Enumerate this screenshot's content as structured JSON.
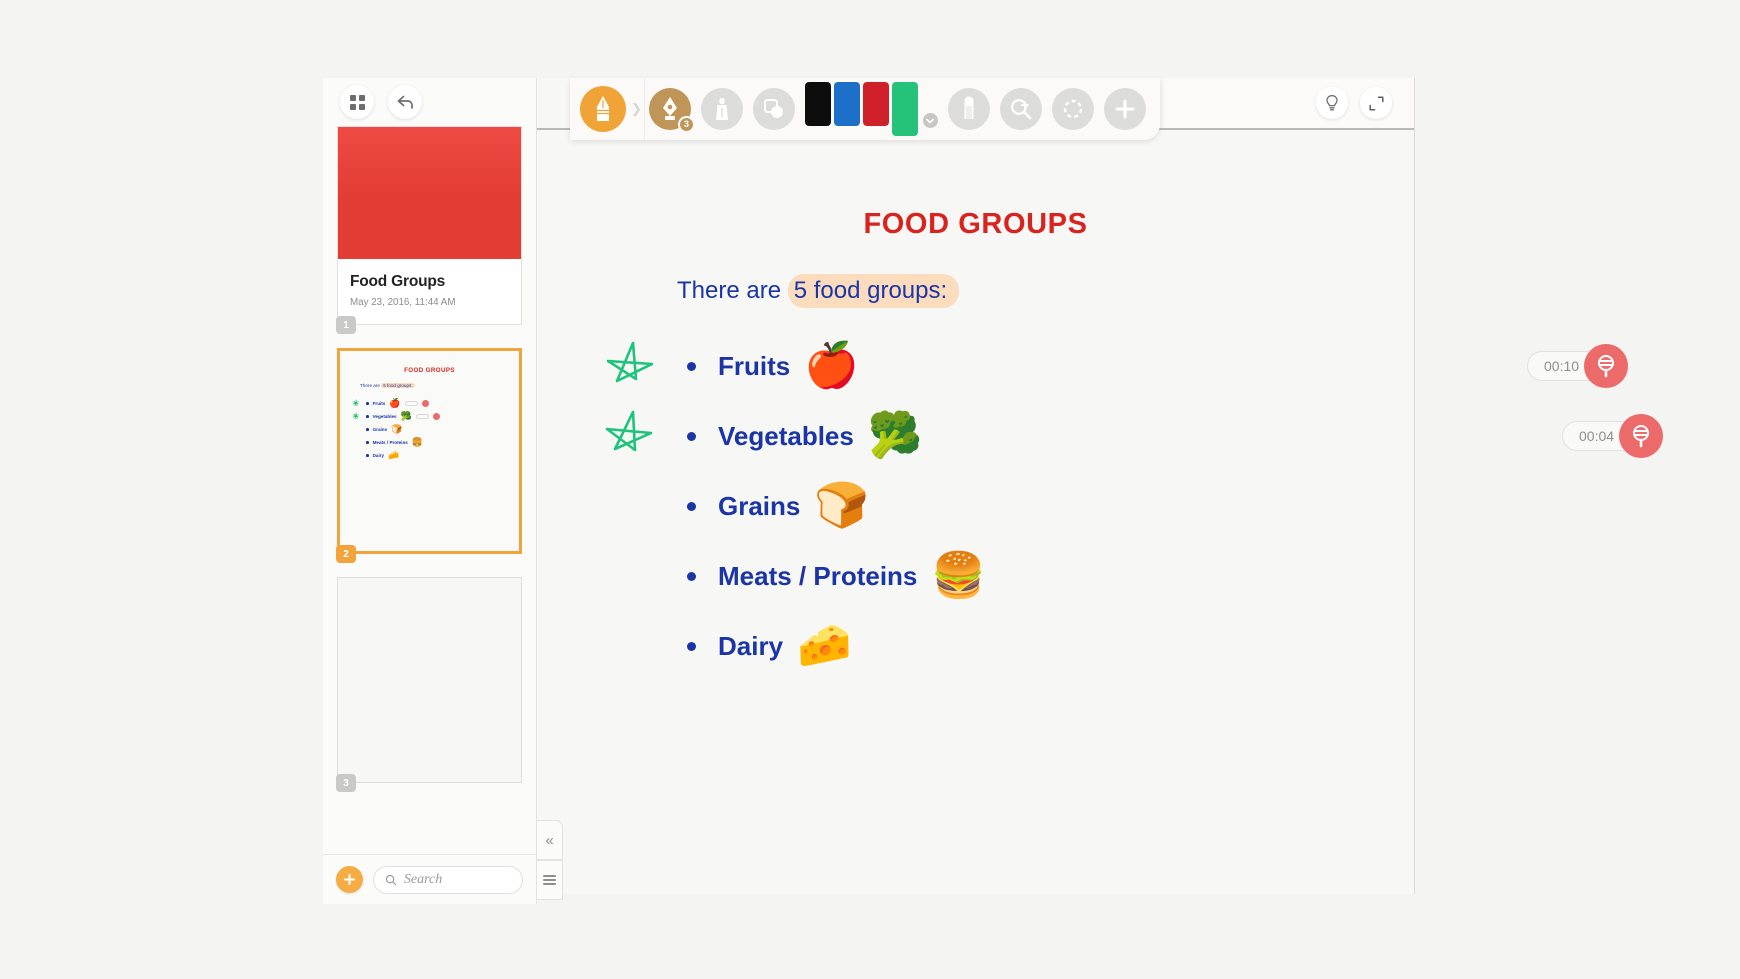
{
  "app": {
    "name": "notebook-presentation-editor"
  },
  "sidebar": {
    "top_buttons": [
      {
        "name": "grid-view-button",
        "icon": "grid-icon"
      },
      {
        "name": "back-button",
        "icon": "back-arrow-icon"
      }
    ],
    "slides": [
      {
        "number": "1",
        "type": "cover",
        "title": "Food Groups",
        "date": "May 23, 2016, 11:44 AM",
        "selected": false,
        "cover_color": "#e23c34"
      },
      {
        "number": "2",
        "type": "content",
        "selected": true,
        "thumb_title": "FOOD GROUPS",
        "thumb_sub_prefix": "There are ",
        "thumb_sub_hl": "5 food groups:",
        "thumb_items": [
          {
            "label": "Fruits",
            "food": "🍎",
            "star": true,
            "rec": true
          },
          {
            "label": "Vegetables",
            "food": "🥦",
            "star": true,
            "rec": true
          },
          {
            "label": "Grains",
            "food": "🍞",
            "star": false,
            "rec": false
          },
          {
            "label": "Meats / Proteins",
            "food": "🍔",
            "star": false,
            "rec": false
          },
          {
            "label": "Dairy",
            "food": "🧀",
            "star": false,
            "rec": false
          }
        ]
      },
      {
        "number": "3",
        "type": "empty",
        "selected": false
      }
    ],
    "add_button_label": "+",
    "search": {
      "placeholder": "Search",
      "value": ""
    }
  },
  "panel_controls": [
    {
      "name": "collapse-panel-button",
      "glyph": "«"
    },
    {
      "name": "panel-menu-button",
      "glyph": "menu"
    }
  ],
  "toolbar": {
    "active_tool": {
      "name": "pencil-tool",
      "color": "#f0a437"
    },
    "tools": [
      {
        "name": "pen-tool",
        "icon": "fountain-pen-icon",
        "color": "#bf9657",
        "badge": "3",
        "active": true
      },
      {
        "name": "highlighter-tool",
        "icon": "highlighter-icon",
        "color": "#dcdcda",
        "badge": "",
        "active": false
      },
      {
        "name": "shape-tool",
        "icon": "shapes-icon",
        "color": "#dcdcda",
        "badge": "",
        "active": false
      }
    ],
    "colors": [
      {
        "name": "swatch-black",
        "hex": "#0d0d0d",
        "selected": false
      },
      {
        "name": "swatch-blue",
        "hex": "#1c70c8",
        "selected": false
      },
      {
        "name": "swatch-red",
        "hex": "#cf2029",
        "selected": false
      },
      {
        "name": "swatch-green",
        "hex": "#25c279",
        "selected": true
      }
    ],
    "more_colors_label": "▾",
    "right_tools": [
      {
        "name": "eraser-tool",
        "icon": "eraser-icon",
        "color": "#dcdcda"
      },
      {
        "name": "zoom-tool",
        "icon": "zoom-in-icon",
        "color": "#dcdcda"
      },
      {
        "name": "selection-tool",
        "icon": "lasso-select-icon",
        "color": "#dcdcda"
      },
      {
        "name": "add-tool",
        "icon": "plus-icon",
        "color": "#dcdcda"
      }
    ],
    "corner_controls": [
      {
        "name": "hint-button",
        "icon": "lightbulb-icon"
      },
      {
        "name": "fullscreen-button",
        "icon": "expand-icon"
      }
    ]
  },
  "slide": {
    "title": "FOOD GROUPS",
    "subtitle_prefix": "There are ",
    "subtitle_highlight": "5 food groups:",
    "highlight_color": "#fbdcbc",
    "title_color": "#d8241f",
    "text_color": "#1b35a6",
    "items": [
      {
        "label": "Fruits",
        "food": "🍎",
        "star": true,
        "recording": "00:10"
      },
      {
        "label": "Vegetables",
        "food": "🥦",
        "star": true,
        "recording": "00:04"
      },
      {
        "label": "Grains",
        "food": "🍞",
        "star": false,
        "recording": ""
      },
      {
        "label": "Meats / Proteins",
        "food": "🍔",
        "star": false,
        "recording": ""
      },
      {
        "label": "Dairy",
        "food": "🧀",
        "star": false,
        "recording": ""
      }
    ]
  }
}
